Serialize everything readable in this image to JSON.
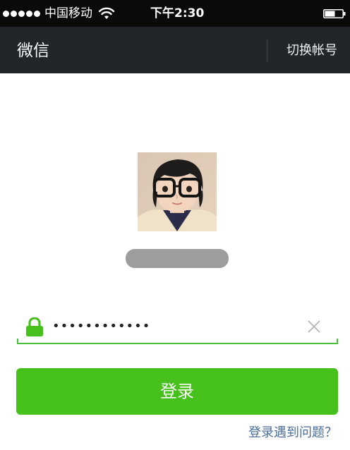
{
  "status_bar": {
    "carrier": "中国移动",
    "time": "下午2:30",
    "signal_bars": 5,
    "icons": [
      "signal-icon",
      "wifi-icon",
      "battery-icon"
    ]
  },
  "nav": {
    "title": "微信",
    "switch_account": "切换帐号"
  },
  "profile": {
    "avatar_icon": "user-avatar-photo"
  },
  "login": {
    "password_value": "••••••••••••",
    "lock_icon": "lock-icon",
    "clear_icon": "close-icon",
    "button_label": "登录",
    "help_link": "登录遇到问题？"
  },
  "colors": {
    "status_bar_bg": "#0a0a0a",
    "nav_bar_bg": "#20262a",
    "accent_green": "#46c01b",
    "link_blue": "#4a6e9b"
  }
}
